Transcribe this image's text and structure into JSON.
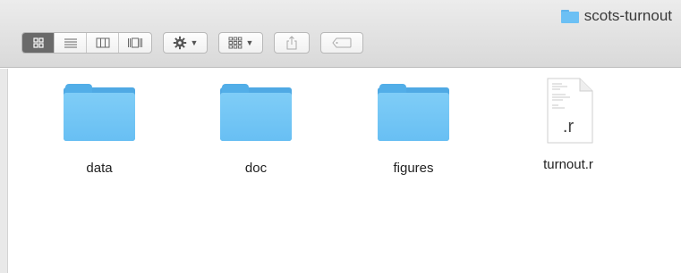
{
  "window": {
    "title": "scots-turnout",
    "title_icon": "folder-icon"
  },
  "toolbar": {
    "view_buttons": [
      "icon-view-icon",
      "list-view-icon",
      "column-view-icon",
      "cover-flow-icon"
    ],
    "action_icon": "gear-icon",
    "arrange_icon": "arrange-grid-icon",
    "share_icon": "share-icon",
    "tags_icon": "tag-icon"
  },
  "files": [
    {
      "name": "data",
      "kind": "folder"
    },
    {
      "name": "doc",
      "kind": "folder"
    },
    {
      "name": "figures",
      "kind": "folder"
    },
    {
      "name": "turnout.r",
      "kind": "document",
      "ext": ".r"
    }
  ],
  "colors": {
    "folder": "#6cc0f4",
    "toolbar_active": "#6a6a6a"
  }
}
